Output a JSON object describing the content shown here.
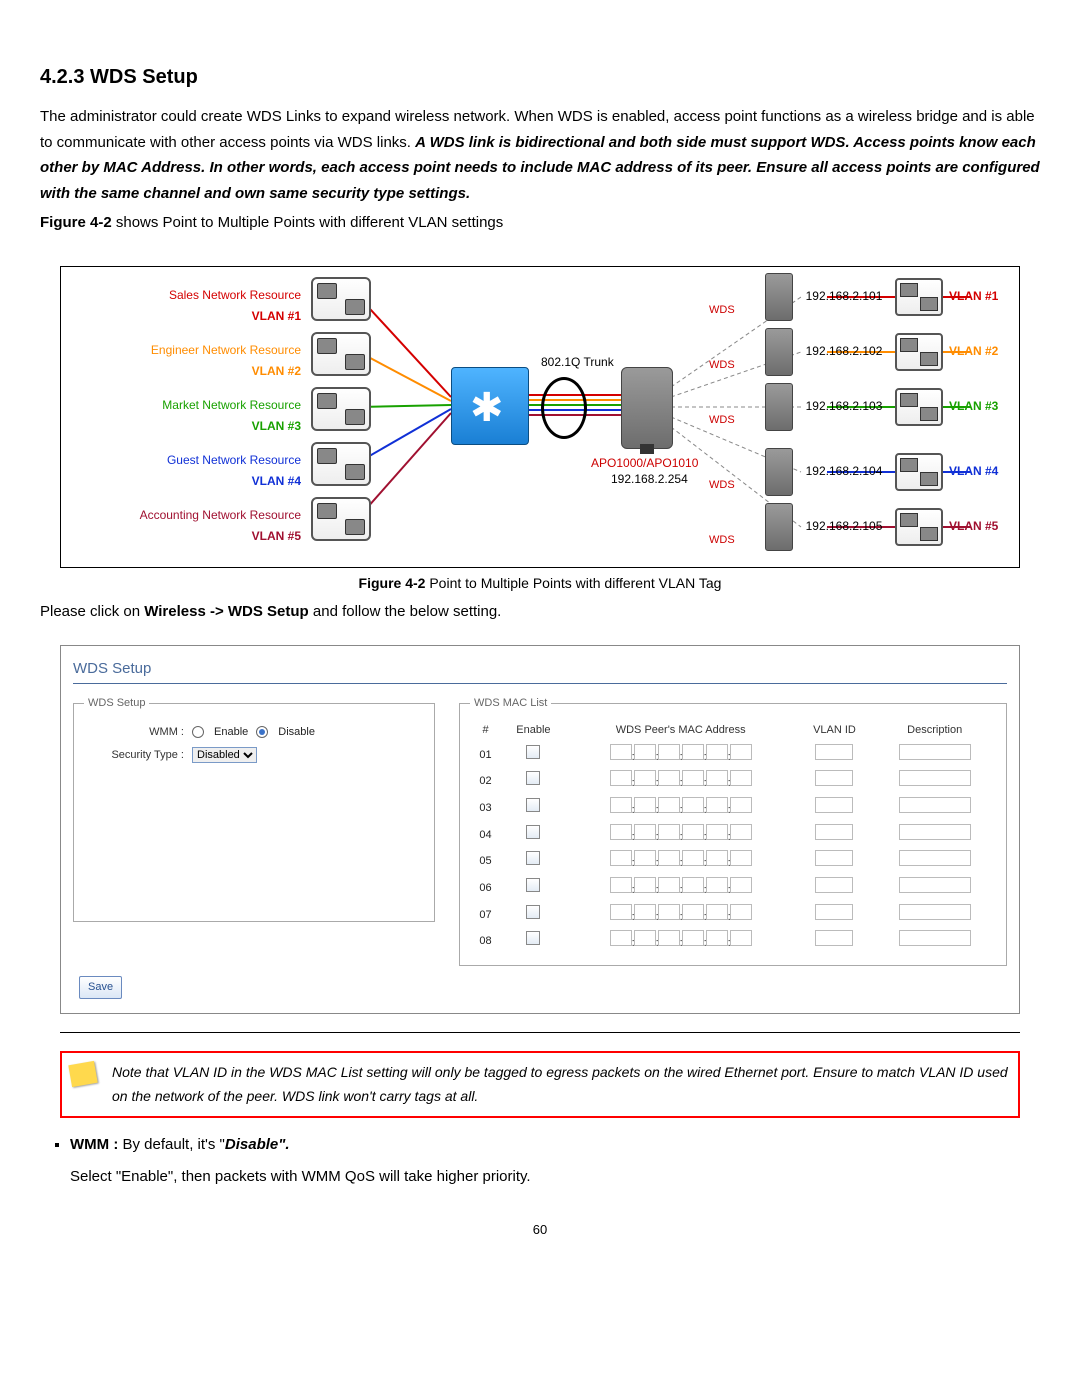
{
  "heading": "4.2.3 WDS Setup",
  "para1_a": "The administrator could create WDS Links to expand wireless network. When WDS is enabled, access point functions as a wireless bridge and is able to communicate with other access points via WDS links. ",
  "para1_b": "A WDS link is bidirectional and both side must support WDS. Access points know each other by MAC Address. In other words, each access point needs to include MAC address of its peer. Ensure all access points are configured with the same channel and own same security type settings.",
  "fig_ref_label": "Figure 4-2",
  "fig_ref_text": " shows Point to Multiple Points with different VLAN settings",
  "fig_caption": " Point to Multiple Points with different VLAN Tag",
  "instr_a": "Please click on ",
  "instr_b": "Wireless -> WDS Setup",
  "instr_c": " and follow the below setting.",
  "diagram": {
    "resources": [
      {
        "label": "Sales Network Resource",
        "vlan": "VLAN #1",
        "color": "#d40000"
      },
      {
        "label": "Engineer Network Resource",
        "vlan": "VLAN #2",
        "color": "#ff8c00"
      },
      {
        "label": "Market Network Resource",
        "vlan": "VLAN #3",
        "color": "#18a100"
      },
      {
        "label": "Guest Network Resource",
        "vlan": "VLAN #4",
        "color": "#1030d6"
      },
      {
        "label": "Accounting Network Resource",
        "vlan": "VLAN #5",
        "color": "#a01030"
      }
    ],
    "trunk_label": "802.1Q Trunk",
    "ap_name": "APO1000/APO1010",
    "ap_ip": "192.168.2.254",
    "wds_label": "WDS",
    "right": [
      {
        "ip": "192.168.2.101",
        "vlan": "VLAN #1",
        "color": "#d40000"
      },
      {
        "ip": "192.168.2.102",
        "vlan": "VLAN #2",
        "color": "#ff8c00"
      },
      {
        "ip": "192.168.2.103",
        "vlan": "VLAN #3",
        "color": "#18a100"
      },
      {
        "ip": "192.168.2.104",
        "vlan": "VLAN #4",
        "color": "#1030d6"
      },
      {
        "ip": "192.168.2.105",
        "vlan": "VLAN #5",
        "color": "#a01030"
      }
    ]
  },
  "shot": {
    "title": "WDS Setup",
    "left_legend": "WDS Setup",
    "wmm_label": "WMM :",
    "enable": "Enable",
    "disable": "Disable",
    "sec_label": "Security Type :",
    "sec_value": "Disabled",
    "right_legend": "WDS MAC List",
    "cols": {
      "num": "#",
      "enable": "Enable",
      "mac": "WDS Peer's MAC Address",
      "vlan": "VLAN ID",
      "desc": "Description"
    },
    "rows": [
      "01",
      "02",
      "03",
      "04",
      "05",
      "06",
      "07",
      "08"
    ],
    "save": "Save"
  },
  "note": "Note that VLAN ID in the WDS MAC List setting will only be tagged to egress packets on the wired Ethernet port. Ensure to match VLAN ID used on the network of the peer. WDS link won't carry tags at all.",
  "wmm_bold": "WMM : ",
  "wmm_a": "By default, it's \"",
  "wmm_b": "Disable",
  "wmm_c": "\".",
  "wmm_line2": "Select \"Enable\", then packets with WMM QoS will take higher priority.",
  "page": "60"
}
